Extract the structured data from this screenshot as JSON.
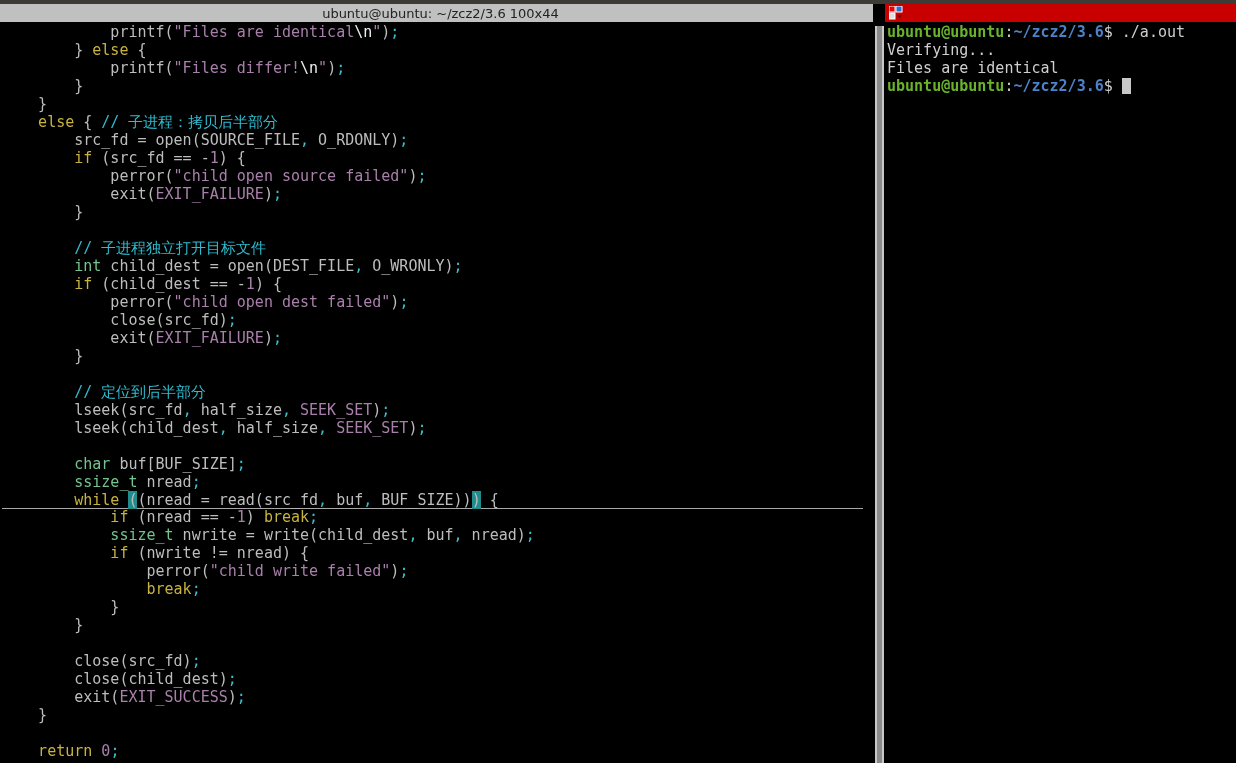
{
  "editor": {
    "title": "ubuntu@ubuntu: ~/zcz2/3.6 100x44",
    "lines": [
      {
        "cursorline": false,
        "tokens": [
          {
            "text": "            printf(",
            "kind": "plain"
          },
          {
            "text": "\"Files are identical",
            "kind": "constant"
          },
          {
            "text": "\\n",
            "kind": "special"
          },
          {
            "text": "\"",
            "kind": "constant"
          },
          {
            "text": ")",
            "kind": "plain"
          },
          {
            "text": ";",
            "kind": "punct"
          }
        ]
      },
      {
        "cursorline": false,
        "tokens": [
          {
            "text": "        } ",
            "kind": "plain"
          },
          {
            "text": "else",
            "kind": "keyword"
          },
          {
            "text": " {",
            "kind": "plain"
          }
        ]
      },
      {
        "cursorline": false,
        "tokens": [
          {
            "text": "            printf(",
            "kind": "plain"
          },
          {
            "text": "\"Files differ!",
            "kind": "constant"
          },
          {
            "text": "\\n",
            "kind": "special"
          },
          {
            "text": "\"",
            "kind": "constant"
          },
          {
            "text": ")",
            "kind": "plain"
          },
          {
            "text": ";",
            "kind": "punct"
          }
        ]
      },
      {
        "cursorline": false,
        "tokens": [
          {
            "text": "        }",
            "kind": "plain"
          }
        ]
      },
      {
        "cursorline": false,
        "tokens": [
          {
            "text": "    }",
            "kind": "plain"
          }
        ]
      },
      {
        "cursorline": false,
        "tokens": [
          {
            "text": "    else",
            "kind": "keyword"
          },
          {
            "text": " { ",
            "kind": "plain"
          },
          {
            "text": "// 子进程：拷贝后半部分",
            "kind": "comment"
          }
        ]
      },
      {
        "cursorline": false,
        "tokens": [
          {
            "text": "        src_fd = open(SOURCE_FILE",
            "kind": "plain"
          },
          {
            "text": ",",
            "kind": "punct"
          },
          {
            "text": " O_RDONLY)",
            "kind": "plain"
          },
          {
            "text": ";",
            "kind": "punct"
          }
        ]
      },
      {
        "cursorline": false,
        "tokens": [
          {
            "text": "        if",
            "kind": "keyword"
          },
          {
            "text": " (src_fd == -",
            "kind": "plain"
          },
          {
            "text": "1",
            "kind": "constant"
          },
          {
            "text": ") {",
            "kind": "plain"
          }
        ]
      },
      {
        "cursorline": false,
        "tokens": [
          {
            "text": "            perror(",
            "kind": "plain"
          },
          {
            "text": "\"child open source failed\"",
            "kind": "constant"
          },
          {
            "text": ")",
            "kind": "plain"
          },
          {
            "text": ";",
            "kind": "punct"
          }
        ]
      },
      {
        "cursorline": false,
        "tokens": [
          {
            "text": "            exit(",
            "kind": "plain"
          },
          {
            "text": "EXIT_FAILURE",
            "kind": "constant"
          },
          {
            "text": ")",
            "kind": "plain"
          },
          {
            "text": ";",
            "kind": "punct"
          }
        ]
      },
      {
        "cursorline": false,
        "tokens": [
          {
            "text": "        }",
            "kind": "plain"
          }
        ]
      },
      {
        "cursorline": false
      },
      {
        "cursorline": false,
        "tokens": [
          {
            "text": "        // 子进程独立打开目标文件",
            "kind": "comment"
          }
        ]
      },
      {
        "cursorline": false,
        "tokens": [
          {
            "text": "        int",
            "kind": "type"
          },
          {
            "text": " child_dest = open(DEST_FILE",
            "kind": "plain"
          },
          {
            "text": ",",
            "kind": "punct"
          },
          {
            "text": " O_WRONLY)",
            "kind": "plain"
          },
          {
            "text": ";",
            "kind": "punct"
          }
        ]
      },
      {
        "cursorline": false,
        "tokens": [
          {
            "text": "        if",
            "kind": "keyword"
          },
          {
            "text": " (child_dest == -",
            "kind": "plain"
          },
          {
            "text": "1",
            "kind": "constant"
          },
          {
            "text": ") {",
            "kind": "plain"
          }
        ]
      },
      {
        "cursorline": false,
        "tokens": [
          {
            "text": "            perror(",
            "kind": "plain"
          },
          {
            "text": "\"child open dest failed\"",
            "kind": "constant"
          },
          {
            "text": ")",
            "kind": "plain"
          },
          {
            "text": ";",
            "kind": "punct"
          }
        ]
      },
      {
        "cursorline": false,
        "tokens": [
          {
            "text": "            close(src_fd)",
            "kind": "plain"
          },
          {
            "text": ";",
            "kind": "punct"
          }
        ]
      },
      {
        "cursorline": false,
        "tokens": [
          {
            "text": "            exit(",
            "kind": "plain"
          },
          {
            "text": "EXIT_FAILURE",
            "kind": "constant"
          },
          {
            "text": ")",
            "kind": "plain"
          },
          {
            "text": ";",
            "kind": "punct"
          }
        ]
      },
      {
        "cursorline": false,
        "tokens": [
          {
            "text": "        }",
            "kind": "plain"
          }
        ]
      },
      {
        "cursorline": false
      },
      {
        "cursorline": false,
        "tokens": [
          {
            "text": "        // 定位到后半部分",
            "kind": "comment"
          }
        ]
      },
      {
        "cursorline": false,
        "tokens": [
          {
            "text": "        lseek(src_fd",
            "kind": "plain"
          },
          {
            "text": ",",
            "kind": "punct"
          },
          {
            "text": " half_size",
            "kind": "plain"
          },
          {
            "text": ",",
            "kind": "punct"
          },
          {
            "text": " SEEK_SET",
            "kind": "constant"
          },
          {
            "text": ")",
            "kind": "plain"
          },
          {
            "text": ";",
            "kind": "punct"
          }
        ]
      },
      {
        "cursorline": false,
        "tokens": [
          {
            "text": "        lseek(child_dest",
            "kind": "plain"
          },
          {
            "text": ",",
            "kind": "punct"
          },
          {
            "text": " half_size",
            "kind": "plain"
          },
          {
            "text": ",",
            "kind": "punct"
          },
          {
            "text": " SEEK_SET",
            "kind": "constant"
          },
          {
            "text": ")",
            "kind": "plain"
          },
          {
            "text": ";",
            "kind": "punct"
          }
        ]
      },
      {
        "cursorline": false
      },
      {
        "cursorline": false,
        "tokens": [
          {
            "text": "        char",
            "kind": "type"
          },
          {
            "text": " buf[BUF_SIZE]",
            "kind": "plain"
          },
          {
            "text": ";",
            "kind": "punct"
          }
        ]
      },
      {
        "cursorline": false,
        "tokens": [
          {
            "text": "        ssize_t",
            "kind": "type"
          },
          {
            "text": " nread",
            "kind": "plain"
          },
          {
            "text": ";",
            "kind": "punct"
          }
        ]
      },
      {
        "cursorline": true,
        "tokens": [
          {
            "text": "        while ",
            "kind": "keyword"
          },
          {
            "text": "(",
            "kind": "match"
          },
          {
            "text": "(nread = read(src_fd",
            "kind": "plain"
          },
          {
            "text": ",",
            "kind": "punct"
          },
          {
            "text": " buf",
            "kind": "plain"
          },
          {
            "text": ",",
            "kind": "punct"
          },
          {
            "text": " BUF_SIZE))",
            "kind": "plain"
          },
          {
            "text": ")",
            "kind": "match"
          },
          {
            "text": " {",
            "kind": "plain"
          }
        ]
      },
      {
        "cursorline": false,
        "tokens": [
          {
            "text": "            if",
            "kind": "keyword"
          },
          {
            "text": " (nread == -",
            "kind": "plain"
          },
          {
            "text": "1",
            "kind": "constant"
          },
          {
            "text": ") ",
            "kind": "plain"
          },
          {
            "text": "break",
            "kind": "keyword"
          },
          {
            "text": ";",
            "kind": "punct"
          }
        ]
      },
      {
        "cursorline": false,
        "tokens": [
          {
            "text": "            ssize_t",
            "kind": "type"
          },
          {
            "text": " nwrite = write(child_dest",
            "kind": "plain"
          },
          {
            "text": ",",
            "kind": "punct"
          },
          {
            "text": " buf",
            "kind": "plain"
          },
          {
            "text": ",",
            "kind": "punct"
          },
          {
            "text": " nread)",
            "kind": "plain"
          },
          {
            "text": ";",
            "kind": "punct"
          }
        ]
      },
      {
        "cursorline": false,
        "tokens": [
          {
            "text": "            if",
            "kind": "keyword"
          },
          {
            "text": " (nwrite != nread) {",
            "kind": "plain"
          }
        ]
      },
      {
        "cursorline": false,
        "tokens": [
          {
            "text": "                perror(",
            "kind": "plain"
          },
          {
            "text": "\"child write failed\"",
            "kind": "constant"
          },
          {
            "text": ")",
            "kind": "plain"
          },
          {
            "text": ";",
            "kind": "punct"
          }
        ]
      },
      {
        "cursorline": false,
        "tokens": [
          {
            "text": "                break",
            "kind": "keyword"
          },
          {
            "text": ";",
            "kind": "punct"
          }
        ]
      },
      {
        "cursorline": false,
        "tokens": [
          {
            "text": "            }",
            "kind": "plain"
          }
        ]
      },
      {
        "cursorline": false,
        "tokens": [
          {
            "text": "        }",
            "kind": "plain"
          }
        ]
      },
      {
        "cursorline": false
      },
      {
        "cursorline": false,
        "tokens": [
          {
            "text": "        close(src_fd)",
            "kind": "plain"
          },
          {
            "text": ";",
            "kind": "punct"
          }
        ]
      },
      {
        "cursorline": false,
        "tokens": [
          {
            "text": "        close(child_dest)",
            "kind": "plain"
          },
          {
            "text": ";",
            "kind": "punct"
          }
        ]
      },
      {
        "cursorline": false,
        "tokens": [
          {
            "text": "        exit(",
            "kind": "plain"
          },
          {
            "text": "EXIT_SUCCESS",
            "kind": "constant"
          },
          {
            "text": ")",
            "kind": "plain"
          },
          {
            "text": ";",
            "kind": "punct"
          }
        ]
      },
      {
        "cursorline": false,
        "tokens": [
          {
            "text": "    }",
            "kind": "plain"
          }
        ]
      },
      {
        "cursorline": false
      },
      {
        "cursorline": false,
        "tokens": [
          {
            "text": "    return",
            "kind": "keyword"
          },
          {
            "text": " 0",
            "kind": "constant"
          },
          {
            "text": ";",
            "kind": "punct"
          }
        ]
      }
    ]
  },
  "terminal": {
    "lines": [
      {
        "kind": "prompt",
        "user": "ubuntu@ubuntu",
        "separator": ":",
        "path": "~/zcz2/3.6",
        "command": "$ ./a.out",
        "cursor": false
      },
      {
        "kind": "output",
        "text": "Verifying..."
      },
      {
        "kind": "output",
        "text": "Files are identical"
      },
      {
        "kind": "prompt",
        "user": "ubuntu@ubuntu",
        "separator": ":",
        "path": "~/zcz2/3.6",
        "command": "$",
        "cursor": true
      }
    ]
  }
}
